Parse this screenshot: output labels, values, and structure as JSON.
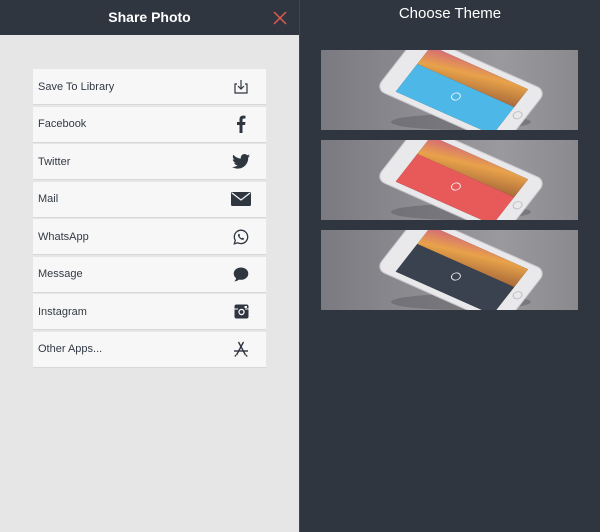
{
  "left": {
    "title": "Share Photo",
    "close_icon": "close-icon",
    "items": [
      {
        "label": "Save To Library",
        "icon": "download-icon"
      },
      {
        "label": "Facebook",
        "icon": "facebook-icon"
      },
      {
        "label": "Twitter",
        "icon": "twitter-icon"
      },
      {
        "label": "Mail",
        "icon": "mail-icon"
      },
      {
        "label": "WhatsApp",
        "icon": "whatsapp-icon"
      },
      {
        "label": "Message",
        "icon": "message-icon"
      },
      {
        "label": "Instagram",
        "icon": "instagram-icon"
      },
      {
        "label": "Other Apps...",
        "icon": "app-store-icon"
      }
    ]
  },
  "right": {
    "title": "Choose Theme",
    "themes": [
      {
        "name": "blue",
        "color": "#4db8e8"
      },
      {
        "name": "red",
        "color": "#e85a5a"
      },
      {
        "name": "dark",
        "color": "#3a4250"
      }
    ]
  },
  "colors": {
    "header_bg": "#2f3640",
    "panel_bg": "#e6e6e6",
    "item_bg": "#f7f7f7",
    "close_accent": "#e05a4f",
    "icon_color": "#2f3640"
  }
}
